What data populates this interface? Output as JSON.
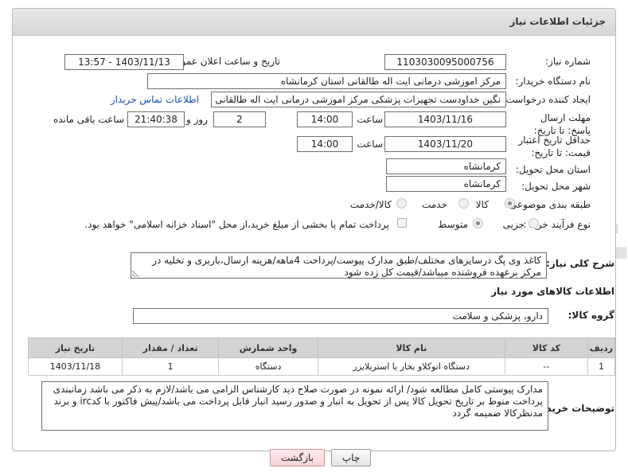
{
  "panel_title": "جزئیات اطلاعات نیاز",
  "need_number": {
    "label": "شماره نیاز:",
    "value": "1103030095000756"
  },
  "announce_datetime": {
    "label": "تاریخ و ساعت اعلان عمومی:",
    "value": "1403/11/13 - 13:57"
  },
  "buyer_org": {
    "label": "نام دستگاه خریدار:",
    "value": "مرکز اموزشی درمانی ایت اله طالقانی استان کرمانشاه"
  },
  "requester": {
    "label": "ایجاد کننده درخواست:",
    "value": "نگین خداودست تجهیزات پزشکی مرکز اموزشی درمانی ایت اله طالقانی استان",
    "contact_link": "اطلاعات تماس خریدار"
  },
  "reply_deadline": {
    "label": "مهلت ارسال پاسخ: تا تاریخ:",
    "date": "1403/11/16",
    "time_label": "ساعت",
    "time": "14:00",
    "days": "2",
    "days_label": "روز و",
    "remaining": "21:40:38",
    "remaining_label": "ساعت باقی مانده"
  },
  "price_validity": {
    "label": "حداقل تاریخ اعتبار قیمت: تا تاریخ:",
    "date": "1403/11/20",
    "time_label": "ساعت",
    "time": "14:00"
  },
  "delivery_province": {
    "label": "استان محل تحویل:",
    "value": "کرمانشاه"
  },
  "delivery_city": {
    "label": "شهر محل تحویل:",
    "value": "کرمانشاه"
  },
  "category": {
    "label": "طبقه بندی موضوعی:",
    "options": [
      "کالا",
      "خدمت",
      "کالا/خدمت"
    ],
    "selected": "کالا"
  },
  "purchase_type": {
    "label": "نوع فرآیند خرید :",
    "options": [
      "جزیی",
      "متوسط"
    ],
    "selected": "متوسط",
    "payment_note": "پرداخت تمام یا بخشی از مبلغ خرید،از محل \"اسناد خزانه اسلامی\" خواهد بود."
  },
  "description": {
    "label": "شرح کلی نیاز:",
    "value": "کاغذ وی پگ درسایزهای مختلف/طبق مدارک پیوست/پرداخت 4ماهه/هزینه ارسال،باربری و تخلیه در مرکز برعهده فروشنده میباشد/قیمت کل زده شود"
  },
  "goods_info_title": "اطلاعات کالاهای مورد نیاز",
  "goods_group": {
    "label": "گروه کالا:",
    "value": "دارو، پزشکی و سلامت"
  },
  "table": {
    "headers": [
      "ردیف",
      "کد کالا",
      "نام کالا",
      "واحد شمارش",
      "تعداد / مقدار",
      "تاریخ نیاز"
    ],
    "rows": [
      [
        "1",
        "--",
        "دستگاه اتوکلاو بخار یا استریلایزر",
        "دستگاه",
        "1",
        "1403/11/18"
      ]
    ]
  },
  "buyer_notes": {
    "label": "توضیحات خریدار:",
    "value": "مدارک پیوستی کامل مطالعه شود/ ارائه نمونه در صورت صلاح دید کارشناس الزامی می باشد/لازم به ذکر می باشد زمانبندی پرداخت منوط بر تاریخ تحویل کالا  پس از تحویل به انبار و صدور رسید انبار قابل پرداخت می باشد/پیش فاکتور با کدirc و برند مدنظرکالا ضمیمه گردد"
  },
  "buttons": {
    "print": "چاپ",
    "back": "بازگشت"
  },
  "watermark_text": "AriaTender.neT"
}
